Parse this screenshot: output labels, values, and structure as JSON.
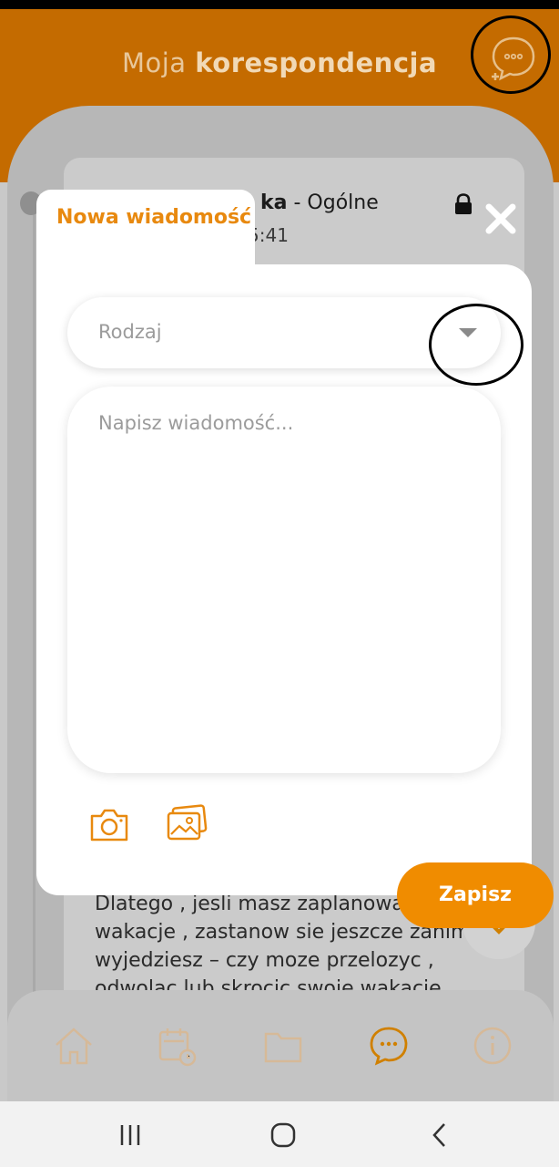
{
  "header": {
    "title_prefix": "Moja",
    "title_bold": "korespondencja"
  },
  "underlying_message": {
    "title_bold": "ka",
    "title_suffix": " - Ogólne",
    "time": "5:41",
    "body": "Dlatego , jesli masz zaplanowane wakacje , zastanow sie jeszcze zanim wyjedziesz – czy moze przelozyc , odwolac lub skrocic swoie wakacje ."
  },
  "modal": {
    "tab_label": "Nowa wiadomość",
    "type_select": {
      "placeholder": "Rodzaj",
      "value": ""
    },
    "message_input": {
      "placeholder": "Napisz wiadomość...",
      "value": ""
    },
    "save_label": "Zapisz"
  },
  "bottom_nav": {
    "items": [
      {
        "icon": "home-icon"
      },
      {
        "icon": "calendar-clock-icon"
      },
      {
        "icon": "folder-icon"
      },
      {
        "icon": "chat-icon",
        "active": true
      },
      {
        "icon": "info-icon"
      }
    ]
  },
  "colors": {
    "accent": "#f08c00",
    "header_bg": "#c46b00",
    "accent_text": "#e8890f"
  }
}
